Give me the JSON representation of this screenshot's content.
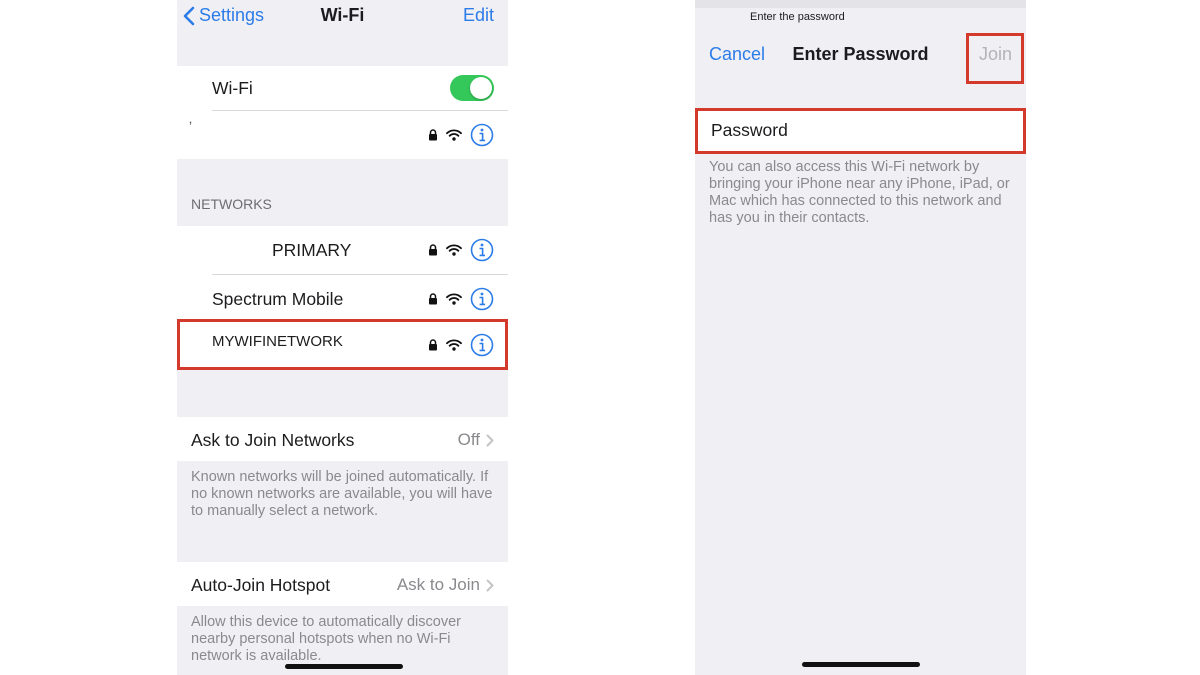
{
  "left": {
    "nav": {
      "back_label": "Settings",
      "title": "Wi-Fi",
      "edit_label": "Edit"
    },
    "wifi_row": {
      "label": "Wi-Fi",
      "toggle_on": true
    },
    "connected_network": {
      "name": "ʼ"
    },
    "networks_header": "NETWORKS",
    "networks": [
      {
        "name": "PRIMARY",
        "secured": true
      },
      {
        "name": "Spectrum Mobile",
        "secured": true
      },
      {
        "name": "MYWIFINETWORK",
        "secured": true,
        "highlighted": true
      }
    ],
    "ask_to_join": {
      "label": "Ask to Join Networks",
      "value": "Off",
      "caption": "Known networks will be joined automatically. If no known networks are available, you will have to manually select a network."
    },
    "auto_join_hotspot": {
      "label": "Auto-Join Hotspot",
      "value": "Ask to Join",
      "caption": "Allow this device to automatically discover nearby personal hotspots when no Wi-Fi network is available."
    }
  },
  "right": {
    "sheet_title": "Enter the password",
    "cancel_label": "Cancel",
    "title": "Enter Password",
    "join_label": "Join",
    "password_placeholder": "Password",
    "caption": "You can also access this Wi-Fi network by bringing your iPhone near any iPhone, iPad, or Mac which has connected to this network and has you in their contacts."
  },
  "colors": {
    "accent": "#2b7ce9",
    "toggle_on": "#34c759",
    "highlight": "#d33a2c",
    "background": "#efeff4"
  }
}
